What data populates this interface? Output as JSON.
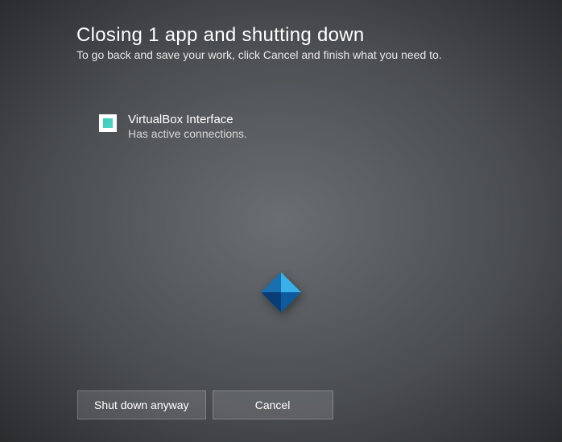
{
  "header": {
    "title": "Closing 1 app and shutting down",
    "subtitle": "To go back and save your work, click Cancel and finish what you need to."
  },
  "apps": [
    {
      "name": "VirtualBox Interface",
      "status": "Has active connections."
    }
  ],
  "buttons": {
    "shutdown": "Shut down anyway",
    "cancel": "Cancel"
  }
}
